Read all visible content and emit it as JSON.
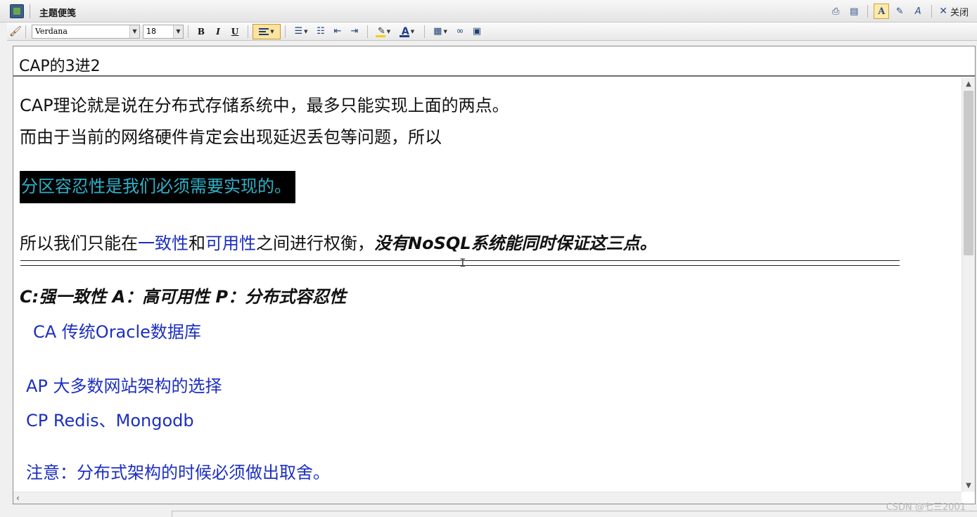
{
  "window": {
    "title": "主题便笺",
    "close_label": "关闭"
  },
  "title_buttons": [
    {
      "name": "print-icon",
      "glyph": "⎙"
    },
    {
      "name": "page-setup-icon",
      "glyph": "🖶"
    },
    {
      "name": "text-mode-icon",
      "glyph": "A"
    },
    {
      "name": "edit-mode-icon",
      "glyph": "✎"
    },
    {
      "name": "format-mode-icon",
      "glyph": "A"
    }
  ],
  "toolbar": {
    "font": "Verdana",
    "size": "18",
    "bold": "B",
    "italic": "I",
    "underline": "U",
    "highlight_color": "#f2d000",
    "font_color": "#1f3a8a"
  },
  "subject": "CAP的3进2",
  "body": {
    "line1": "CAP理论就是说在分布式存储系统中，最多只能实现上面的两点。",
    "line2": "而由于当前的网络硬件肯定会出现延迟丢包等问题，所以",
    "highlight": "分区容忍性是我们必须需要实现的。",
    "line4": {
      "a": "所以我们只能在",
      "b": "一致性",
      "c": "和",
      "d": "可用性",
      "e": "之间进行权衡，",
      "f": "没有NoSQL系统能同时保证这三点。"
    },
    "definitions": "C:强一致性  A：高可用性  P：分布式容忍性",
    "ca": "CA 传统Oracle数据库",
    "ap": "AP 大多数网站架构的选择",
    "cp": "CP Redis、Mongodb",
    "note": "注意：分布式架构的时候必须做出取舍。"
  },
  "watermark": "CSDN @七三2001",
  "colors": {
    "accent_blue": "#1c2fbf",
    "highlight_text": "#2fb1c8",
    "active_button": "#fde3a0"
  }
}
